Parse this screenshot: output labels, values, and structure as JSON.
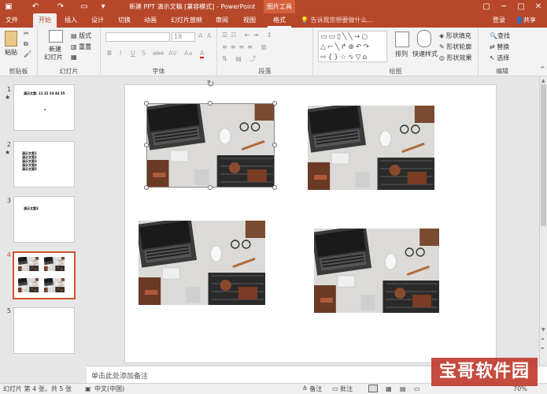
{
  "titlebar": {
    "title": "新建 PPT 演示文稿 [兼容模式] - PowerPoint",
    "context_tab": "图片工具",
    "quick_access": [
      "save-icon",
      "undo-icon",
      "redo-icon",
      "slideshow-icon",
      "customize-icon"
    ]
  },
  "tabs": [
    "文件",
    "开始",
    "插入",
    "设计",
    "切换",
    "动画",
    "幻灯片放映",
    "审阅",
    "视图",
    "格式"
  ],
  "active_tab": "开始",
  "tell_me": "告诉我您想要做什么...",
  "account": {
    "login": "登录",
    "share": "共享"
  },
  "ribbon": {
    "clipboard": {
      "label": "剪贴板",
      "paste": "粘贴"
    },
    "slides": {
      "label": "幻灯片",
      "new_slide": "新建",
      "new_slide2": "幻灯片",
      "layout": "版式",
      "reset": "重置"
    },
    "font": {
      "label": "字体",
      "size": "18",
      "buttons": [
        "B",
        "I",
        "U",
        "S",
        "abc",
        "AV",
        "Aa",
        "A"
      ]
    },
    "paragraph": {
      "label": "段落"
    },
    "drawing": {
      "label": "绘图",
      "arrange": "排列",
      "quick_styles": "快速样式",
      "fill": "形状填充",
      "outline": "形状轮廓",
      "effects": "形状效果"
    },
    "editing": {
      "label": "编辑",
      "find": "查找",
      "replace": "替换",
      "select": "选择"
    }
  },
  "thumbnails": [
    {
      "num": "1",
      "star": "★",
      "text": "演示文案: 11 22 33 44 55"
    },
    {
      "num": "2",
      "star": "★",
      "lines": [
        "演示文案1",
        "演示文案2",
        "演示文案3",
        "演示文案4",
        "演示文案5"
      ]
    },
    {
      "num": "3",
      "star": "",
      "text": "演示文案3"
    },
    {
      "num": "4",
      "star": "",
      "text": ""
    },
    {
      "num": "5",
      "star": "",
      "text": ""
    }
  ],
  "notes_placeholder": "单击此处添加备注",
  "status": {
    "slide_info": "幻灯片 第 4 张，共 5 张",
    "language": "中文(中国)",
    "notes": "备注",
    "comments": "批注",
    "zoom": "70%"
  },
  "watermark": "宝哥软件园",
  "colors": {
    "accent": "#b7472a",
    "selection": "#d35230"
  }
}
